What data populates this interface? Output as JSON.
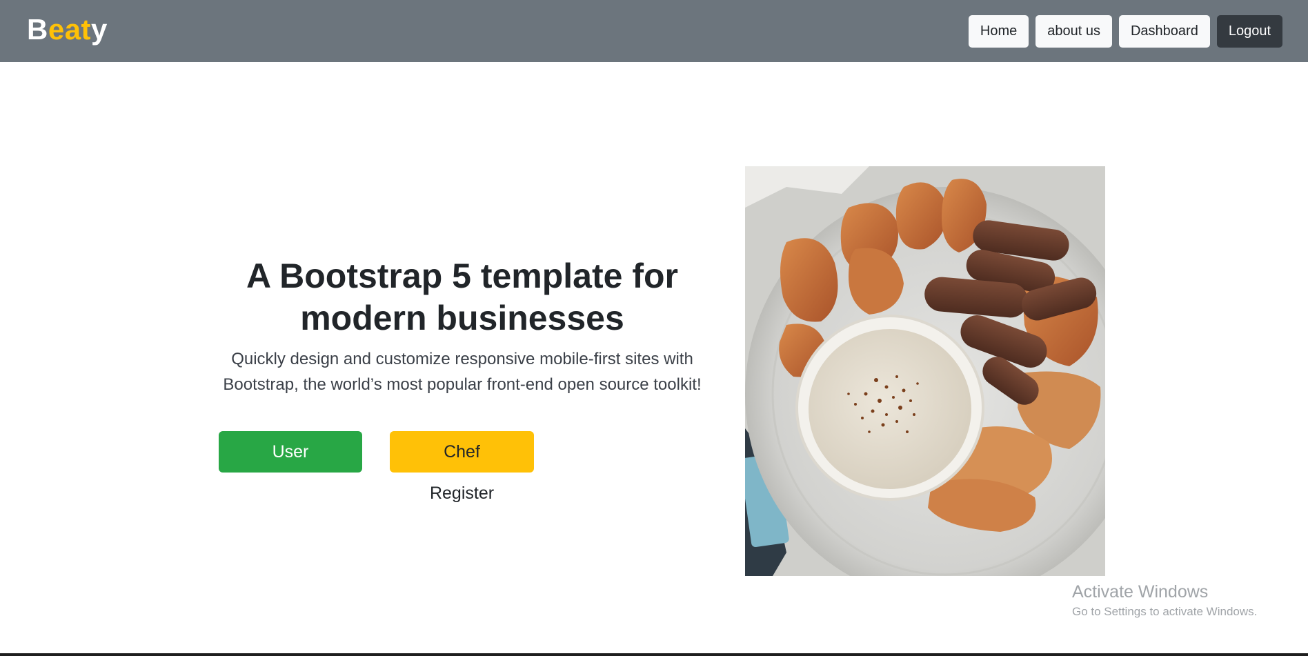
{
  "brand": {
    "first": "B",
    "middle": "eat",
    "last": "y"
  },
  "nav": {
    "home": "Home",
    "about": "about us",
    "dashboard": "Dashboard",
    "logout": "Logout"
  },
  "hero": {
    "title": "A Bootstrap 5 template for modern businesses",
    "lead": "Quickly design and customize responsive mobile-first sites with Bootstrap, the world’s most popular front-end open source toolkit!",
    "user_register": "User Register",
    "chef_register": "Chef Register"
  },
  "watermark": {
    "line1": "Activate Windows",
    "line2": "Go to Settings to activate Windows."
  },
  "colors": {
    "navbar": "#6c757d",
    "brand_accent": "#ffc107",
    "success": "#28a745",
    "warning": "#ffc107",
    "dark": "#343a40"
  }
}
